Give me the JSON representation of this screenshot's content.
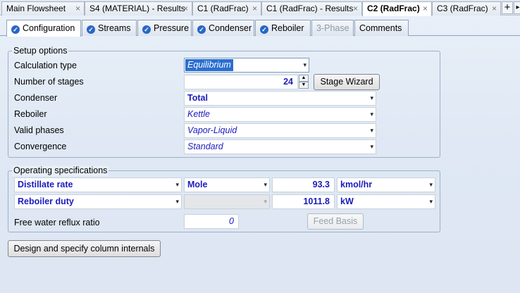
{
  "doc_tabs": [
    {
      "label": "Main Flowsheet",
      "close": "×"
    },
    {
      "label": "S4 (MATERIAL) - Results",
      "close": "×"
    },
    {
      "label": "C1 (RadFrac)",
      "close": "×"
    },
    {
      "label": "C1 (RadFrac) - Results",
      "close": "×"
    },
    {
      "label": "C2 (RadFrac)",
      "close": "×"
    },
    {
      "label": "C3 (RadFrac)",
      "close": "×"
    }
  ],
  "add_tab": "+",
  "form_tabs": [
    {
      "label": "Configuration",
      "check": "✓"
    },
    {
      "label": "Streams",
      "check": "✓"
    },
    {
      "label": "Pressure",
      "check": "✓"
    },
    {
      "label": "Condenser",
      "check": "✓"
    },
    {
      "label": "Reboiler",
      "check": "✓"
    },
    {
      "label": "3-Phase"
    },
    {
      "label": "Comments"
    }
  ],
  "setup": {
    "title": "Setup options",
    "calc_type_label": "Calculation type",
    "calc_type_value": "Equilibrium",
    "stages_label": "Number of stages",
    "stages_value": "24",
    "stage_wizard": "Stage Wizard",
    "condenser_label": "Condenser",
    "condenser_value": "Total",
    "reboiler_label": "Reboiler",
    "reboiler_value": "Kettle",
    "valid_phases_label": "Valid phases",
    "valid_phases_value": "Vapor-Liquid",
    "convergence_label": "Convergence",
    "convergence_value": "Standard"
  },
  "opspec": {
    "title": "Operating specifications",
    "spec1": {
      "name": "Distillate rate",
      "basis": "Mole",
      "value": "93.3",
      "units": "kmol/hr"
    },
    "spec2": {
      "name": "Reboiler duty",
      "basis": "",
      "value": "1011.8",
      "units": "kW"
    },
    "free_water_label": "Free water reflux ratio",
    "free_water_value": "0",
    "feed_basis": "Feed Basis"
  },
  "design_button": "Design and specify column internals",
  "icons": {
    "dropdown": "▾",
    "spin_up": "▲",
    "spin_down": "▼"
  }
}
